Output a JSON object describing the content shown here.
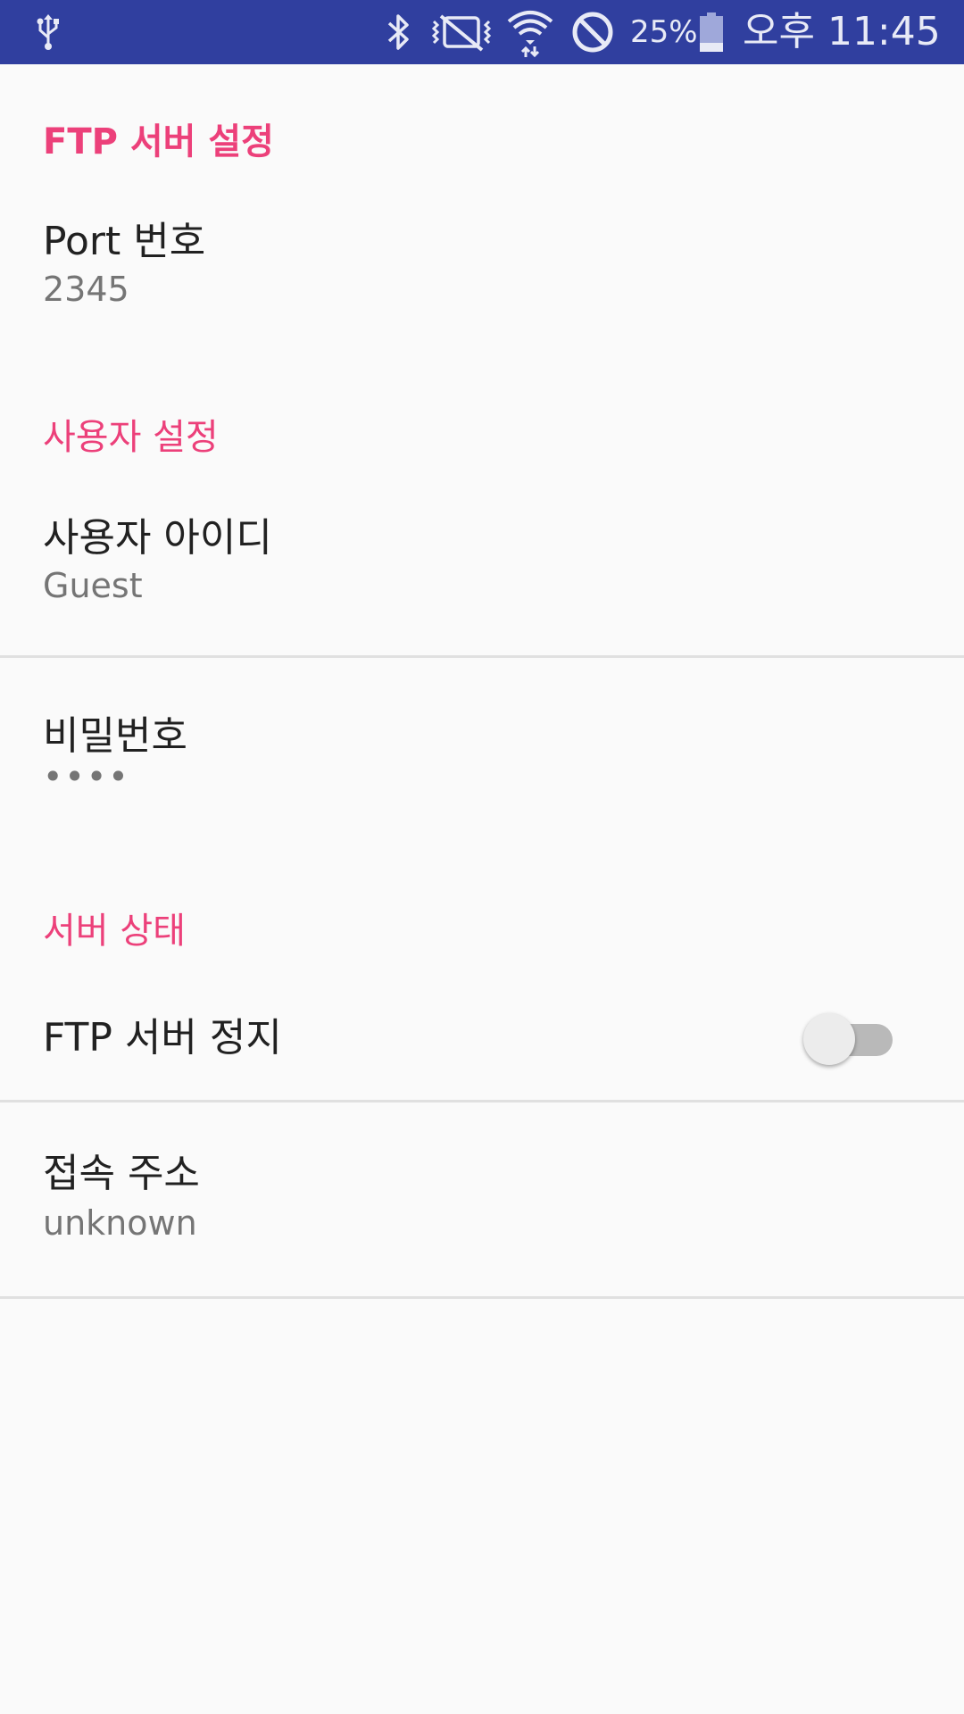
{
  "status_bar": {
    "background": "#303f9f",
    "icons": [
      "usb-icon",
      "bluetooth-icon",
      "vibrate-mute-icon",
      "wifi-icon",
      "do-not-disturb-icon",
      "battery-icon"
    ],
    "battery_percent": "25%",
    "battery_level": 0.25,
    "time": "오후 11:45"
  },
  "accent_color": "#ec407a",
  "sections": {
    "ftp_server": {
      "header": "FTP 서버 설정",
      "port": {
        "title": "Port 번호",
        "summary": "2345"
      }
    },
    "user": {
      "header": "사용자 설정",
      "user_id": {
        "title": "사용자 아이디",
        "summary": "Guest"
      },
      "password": {
        "title": "비밀번호",
        "summary": "••••"
      }
    },
    "server_status": {
      "header": "서버 상태",
      "server_toggle": {
        "title": "FTP 서버 정지",
        "checked": false
      },
      "address": {
        "title": "접속 주소",
        "summary": "unknown"
      }
    }
  }
}
